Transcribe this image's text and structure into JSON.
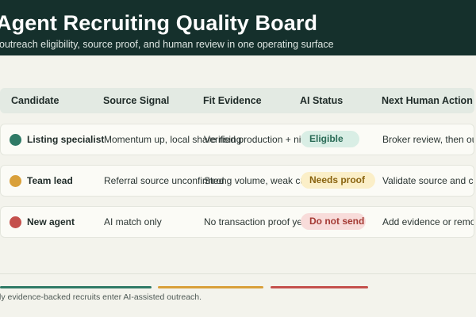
{
  "header": {
    "title": "Agent Recruiting Quality Board",
    "subtitle": "outreach eligibility, source proof, and human review in one operating surface"
  },
  "table": {
    "columns": [
      "Candidate",
      "Source Signal",
      "Fit Evidence",
      "AI Status",
      "Next Human Action"
    ],
    "rows": [
      {
        "candidate": "Listing specialist",
        "source_signal": "Momentum up, local share rising",
        "fit_evidence": "Verified production + niche",
        "ai_status": "Eligible",
        "next_action": "Broker review, then outreach",
        "status_color": "#2f7a66"
      },
      {
        "candidate": "Team lead",
        "source_signal": "Referral source unconfirmed",
        "fit_evidence": "Strong volume, weak culture",
        "ai_status": "Needs proof",
        "next_action": "Validate source and context",
        "status_color": "#d9a03a"
      },
      {
        "candidate": "New agent",
        "source_signal": "AI match only",
        "fit_evidence": "No transaction proof yet",
        "ai_status": "Do not send",
        "next_action": "Add evidence or remove",
        "status_color": "#c4504c"
      }
    ]
  },
  "footer": {
    "note": "ly evidence-backed recruits enter AI-assisted outreach."
  },
  "colors": {
    "header_bg": "#15302c",
    "eligible": "#2f7a66",
    "needs_proof": "#d9a03a",
    "do_not_send": "#c4504c"
  }
}
